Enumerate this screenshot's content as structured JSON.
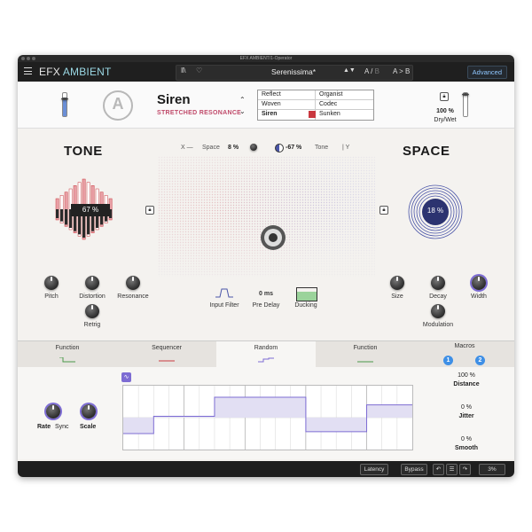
{
  "window": {
    "title": "EFX AMBIENT/1-Operator"
  },
  "header": {
    "brand_a": "EFX",
    "brand_b": "AMBIENT",
    "preset_name": "Serenissima*",
    "ab_a": "A",
    "ab_b": "B",
    "ab_copy": "A > B",
    "advanced_label": "Advanced"
  },
  "preset": {
    "name": "Siren",
    "subtitle": "STRETCHED RESONANCE",
    "table": [
      [
        "Reflect",
        "Organist"
      ],
      [
        "Woven",
        "Codec"
      ],
      [
        "Siren",
        "Sunken"
      ]
    ],
    "selected": "Siren",
    "accent_color": "#c9383f"
  },
  "drywet": {
    "value": "100 %",
    "label": "Dry/Wet",
    "level": 1.0
  },
  "input_level": 0.8,
  "tone": {
    "title": "TONE",
    "value": "67 %",
    "knobs": [
      {
        "label": "Pitch"
      },
      {
        "label": "Distortion"
      },
      {
        "label": "Resonance"
      },
      {
        "label": "Retrig"
      }
    ]
  },
  "space": {
    "title": "SPACE",
    "value": "18 %",
    "knobs": [
      {
        "label": "Size"
      },
      {
        "label": "Decay"
      },
      {
        "label": "Width"
      },
      {
        "label": "Modulation"
      }
    ]
  },
  "xy": {
    "x_label": "X —",
    "space_label": "Space",
    "space_value": "8 %",
    "tone_value": "-67 %",
    "tone_label": "Tone",
    "y_label": "| Y"
  },
  "middle": {
    "input_filter": "Input Filter",
    "pre_delay_value": "0 ms",
    "pre_delay": "Pre Delay",
    "ducking": "Ducking"
  },
  "tabs": [
    {
      "label": "Function"
    },
    {
      "label": "Sequencer"
    },
    {
      "label": "Random"
    },
    {
      "label": "Function"
    },
    {
      "label": "Macros"
    }
  ],
  "macros": [
    "1",
    "2"
  ],
  "random": {
    "rate_label": "Rate",
    "sync_label": "Sync",
    "scale_label": "Scale",
    "distance_value": "100 %",
    "distance_label": "Distance",
    "jitter_value": "0 %",
    "jitter_label": "Jitter",
    "smooth_value": "0 %",
    "smooth_label": "Smooth",
    "steps": [
      0.25,
      0.25,
      0.52,
      0.52,
      0.52,
      0.52,
      0.82,
      0.82,
      0.82,
      0.82,
      0.82,
      0.82,
      0.28,
      0.28,
      0.28,
      0.28,
      0.7,
      0.7,
      0.7
    ]
  },
  "footer": {
    "latency": "Latency",
    "bypass": "Bypass",
    "zoom": "3%"
  },
  "colors": {
    "accent": "#7d6cd3",
    "tone_red": "#c9383f",
    "space_blue": "#4a55a8"
  }
}
